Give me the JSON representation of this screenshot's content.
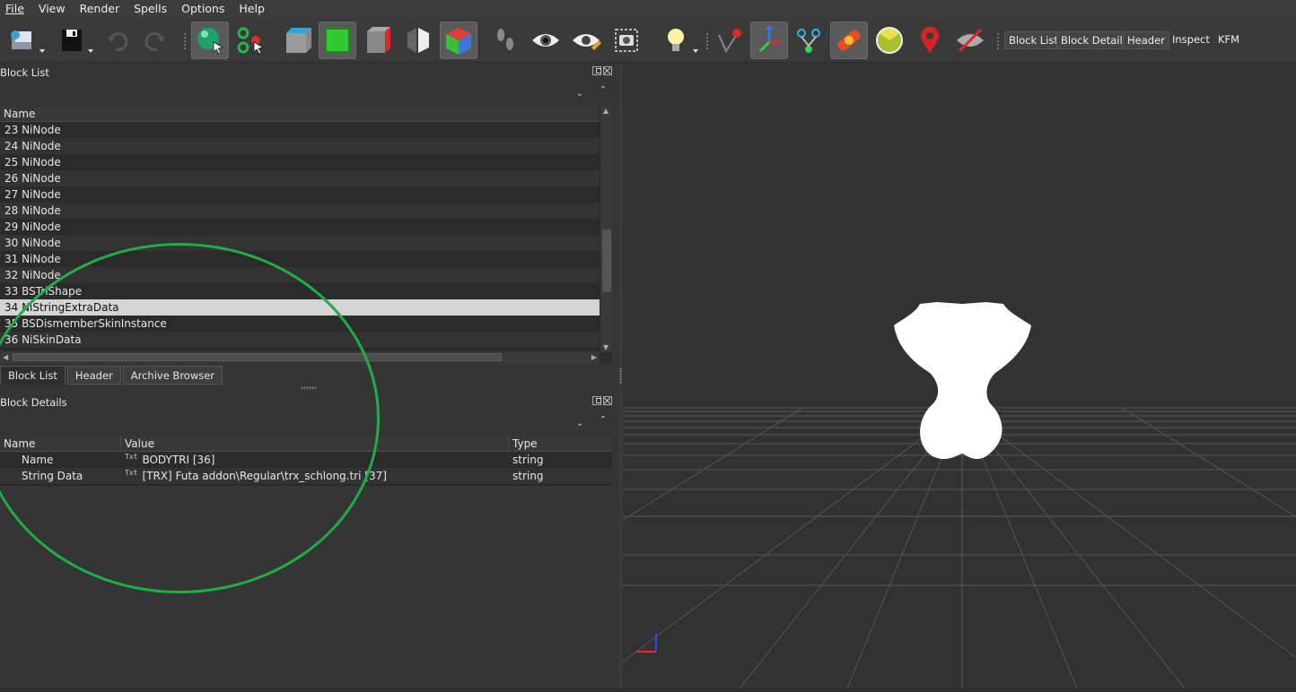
{
  "menu": [
    "File",
    "View",
    "Render",
    "Spells",
    "Options",
    "Help"
  ],
  "toolbar": {
    "icons": [
      "open-folder-icon",
      "save-icon",
      "undo-icon",
      "redo-icon",
      "select-object-icon",
      "select-vertex-icon",
      "flat-shading-icon",
      "textured-shading-icon",
      "wireframe-box-icon",
      "hide-toggle-icon",
      "color-cube-icon",
      "footprints-icon",
      "show-hidden-icon",
      "visibility-edit-icon",
      "screenshot-icon",
      "lighting-icon",
      "show-markers-icon",
      "show-axes-icon",
      "show-nodes-icon",
      "show-havok-icon",
      "show-constraints-icon",
      "show-furniture-icon",
      "hide-markers-icon"
    ],
    "text_buttons": [
      "Block List",
      "Block Details",
      "Header",
      "Inspect",
      "KFM"
    ]
  },
  "block_list": {
    "title": "Block List",
    "column": "Name",
    "rows": [
      "23 NiNode",
      "24 NiNode",
      "25 NiNode",
      "26 NiNode",
      "27 NiNode",
      "28 NiNode",
      "29 NiNode",
      "30 NiNode",
      "31 NiNode",
      "32 NiNode",
      "33 BSTriShape",
      "34 NiStringExtraData",
      "35 BSDismemberSkinInstance",
      "36 NiSkinData"
    ],
    "selected_index": 11
  },
  "tabs": [
    "Block List",
    "Header",
    "Archive Browser"
  ],
  "block_details": {
    "title": "Block Details",
    "columns": [
      "Name",
      "Value",
      "Type"
    ],
    "txt_icon": "Txt",
    "rows": [
      {
        "name": "Name",
        "value": "BODYTRI [36]",
        "type": "string"
      },
      {
        "name": "String Data",
        "value": "[TRX] Futa addon\\Regular\\trx_schlong.tri [37]",
        "type": "string"
      }
    ]
  },
  "colors": {
    "annotation_ellipse": "#1fad45",
    "selection": "#d4d4d4",
    "viewport_bg": "#323232"
  }
}
